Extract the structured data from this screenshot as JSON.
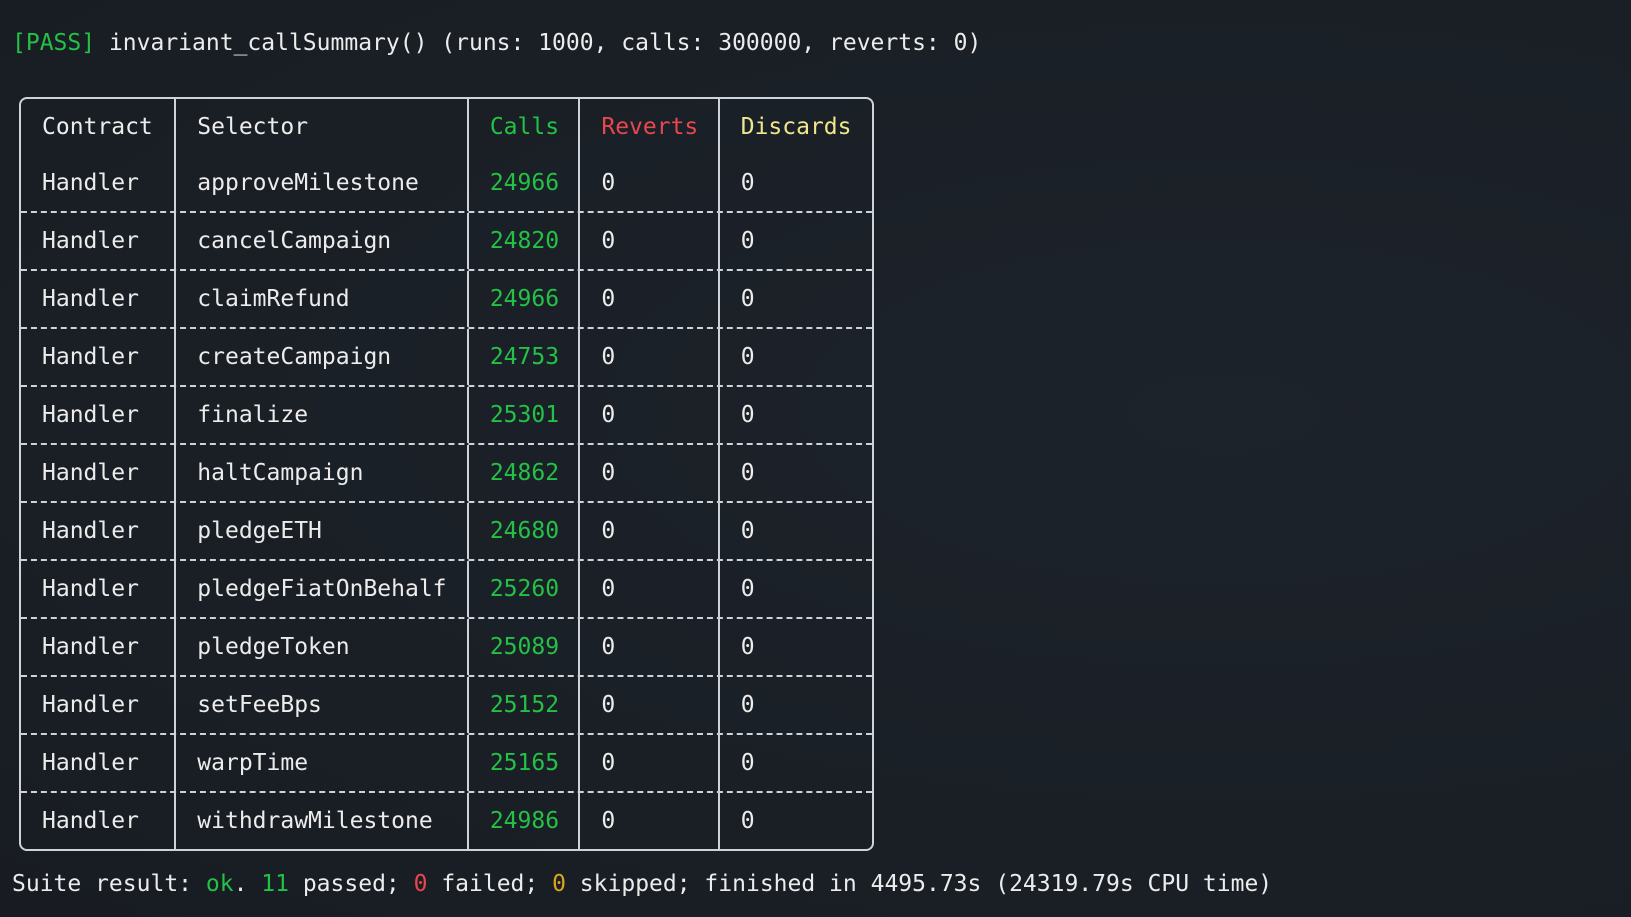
{
  "pass_line": {
    "tag": "[PASS]",
    "text": " invariant_callSummary() (runs: 1000, calls: 300000, reverts: 0)"
  },
  "table": {
    "headers": {
      "contract": "Contract",
      "selector": "Selector",
      "calls": "Calls",
      "reverts": "Reverts",
      "discards": "Discards"
    },
    "rows": [
      {
        "contract": "Handler",
        "selector": "approveMilestone",
        "calls": "24966",
        "reverts": "0",
        "discards": "0"
      },
      {
        "contract": "Handler",
        "selector": "cancelCampaign",
        "calls": "24820",
        "reverts": "0",
        "discards": "0"
      },
      {
        "contract": "Handler",
        "selector": "claimRefund",
        "calls": "24966",
        "reverts": "0",
        "discards": "0"
      },
      {
        "contract": "Handler",
        "selector": "createCampaign",
        "calls": "24753",
        "reverts": "0",
        "discards": "0"
      },
      {
        "contract": "Handler",
        "selector": "finalize",
        "calls": "25301",
        "reverts": "0",
        "discards": "0"
      },
      {
        "contract": "Handler",
        "selector": "haltCampaign",
        "calls": "24862",
        "reverts": "0",
        "discards": "0"
      },
      {
        "contract": "Handler",
        "selector": "pledgeETH",
        "calls": "24680",
        "reverts": "0",
        "discards": "0"
      },
      {
        "contract": "Handler",
        "selector": "pledgeFiatOnBehalf",
        "calls": "25260",
        "reverts": "0",
        "discards": "0"
      },
      {
        "contract": "Handler",
        "selector": "pledgeToken",
        "calls": "25089",
        "reverts": "0",
        "discards": "0"
      },
      {
        "contract": "Handler",
        "selector": "setFeeBps",
        "calls": "25152",
        "reverts": "0",
        "discards": "0"
      },
      {
        "contract": "Handler",
        "selector": "warpTime",
        "calls": "25165",
        "reverts": "0",
        "discards": "0"
      },
      {
        "contract": "Handler",
        "selector": "withdrawMilestone",
        "calls": "24986",
        "reverts": "0",
        "discards": "0"
      }
    ]
  },
  "suite_line": {
    "prefix": "Suite result: ",
    "status": "ok",
    "dot": ". ",
    "passed_count": "11",
    "passed_label": " passed; ",
    "failed_count": "0",
    "failed_label": " failed; ",
    "skipped_count": "0",
    "rest": " skipped; finished in 4495.73s (24319.79s CPU time)"
  },
  "colors": {
    "background": "#1a1f26",
    "pass": "#23c146",
    "calls": "#23c146",
    "reverts": "#e8474f",
    "discards": "#f0e68c",
    "failed": "#e8474f",
    "skipped": "#d8a51b"
  }
}
